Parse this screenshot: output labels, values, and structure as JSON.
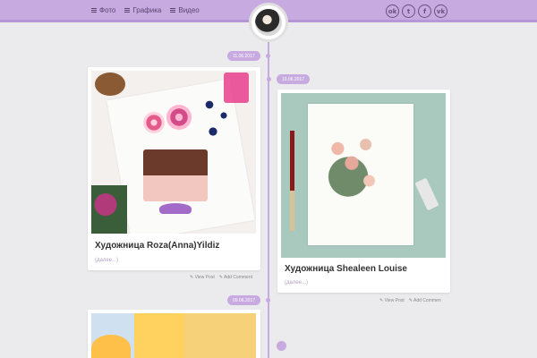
{
  "header": {
    "nav": [
      {
        "label": "Фото"
      },
      {
        "label": "Графика"
      },
      {
        "label": "Видео"
      }
    ],
    "socials": [
      {
        "name": "odnoklassniki-icon",
        "glyph": "ok"
      },
      {
        "name": "twitter-icon",
        "glyph": "t"
      },
      {
        "name": "facebook-icon",
        "glyph": "f"
      },
      {
        "name": "vk-icon",
        "glyph": "vk"
      }
    ]
  },
  "timeline": {
    "accent_color": "#c7aae0",
    "dates": [
      "11.06.2017",
      "10.06.2017",
      "09.06.2017"
    ]
  },
  "posts": [
    {
      "title": "Художница Roza(Anna)Yildiz",
      "more": "(далее...)",
      "view_post": "✎ View Post",
      "add_comment": "✎ Add Comment"
    },
    {
      "title": "Художница Shealeen Louise",
      "more": "(далее...)",
      "view_post": "✎ View Post",
      "add_comment": "✎ Add Commen"
    }
  ]
}
